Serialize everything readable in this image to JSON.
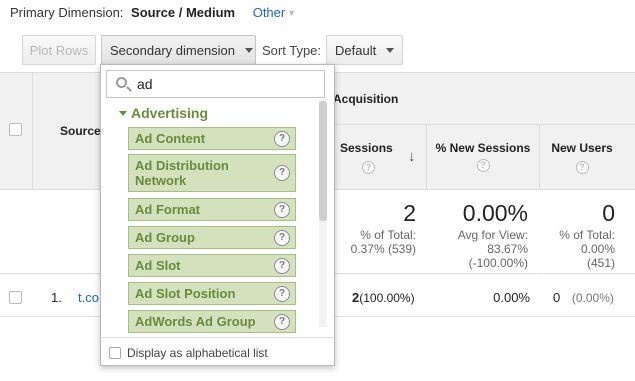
{
  "primary": {
    "label": "Primary Dimension:",
    "current": "Source / Medium",
    "other": "Other"
  },
  "toolbar": {
    "plot_rows": "Plot Rows",
    "secondary_dimension": "Secondary dimension",
    "sort_type_label": "Sort Type:",
    "sort_default": "Default"
  },
  "table": {
    "source_header": "Source",
    "acquisition": "Acquisition",
    "columns": [
      {
        "label": "Sessions"
      },
      {
        "label": "% New Sessions"
      },
      {
        "label": "New Users"
      }
    ],
    "totals": [
      {
        "value": "2",
        "line1": "% of Total:",
        "line2": "0.37% (539)"
      },
      {
        "value": "0.00%",
        "line1": "Avg for View:",
        "line2": "83.67%",
        "line3": "(-100.00%)"
      },
      {
        "value": "0",
        "line1": "% of Total:",
        "line2": "0.00%",
        "line3": "(451)"
      }
    ],
    "row": {
      "index": "1.",
      "source": "t.co",
      "sessions": "2",
      "sessions_pct": "(100.00%)",
      "new_sessions": "0.00%",
      "new_users": "0",
      "new_users_pct": "(0.00%)"
    }
  },
  "dropdown": {
    "search_value": "ad",
    "group": "Advertising",
    "options": [
      "Ad Content",
      "Ad Distribution Network",
      "Ad Format",
      "Ad Group",
      "Ad Slot",
      "Ad Slot Position",
      "AdWords Ad Group"
    ],
    "footer_label": "Display as alphabetical list"
  },
  "help_glyph": "?",
  "colors": {
    "link": "#1a63c6",
    "option_bg": "#d3e2bc",
    "option_text": "#6a8a40"
  }
}
